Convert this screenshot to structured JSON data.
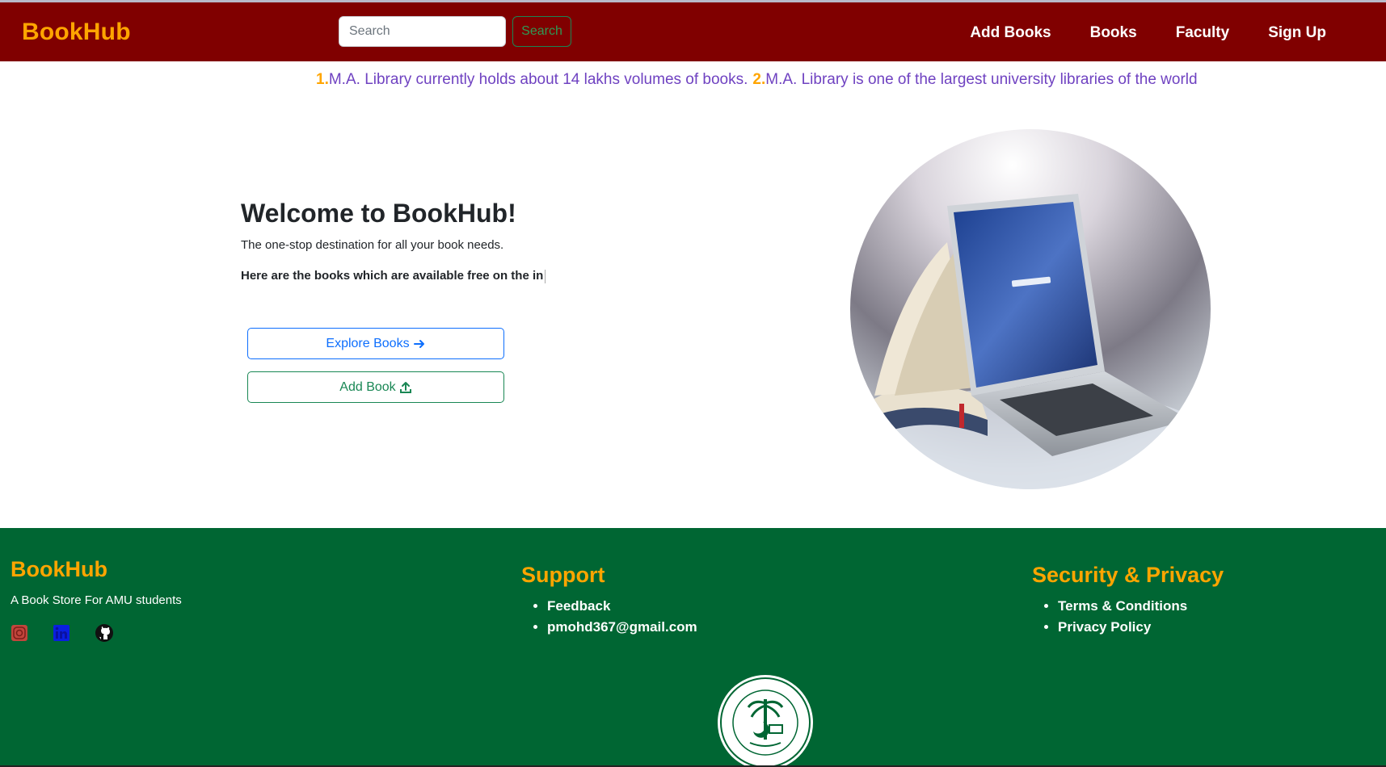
{
  "navbar": {
    "brand": "BookHub",
    "search_placeholder": "Search",
    "search_button": "Search",
    "links": [
      "Add Books",
      "Books",
      "Faculty",
      "Sign Up"
    ]
  },
  "facts": [
    {
      "num": "1.",
      "text": "M.A. Library currently holds about 14 lakhs volumes of books."
    },
    {
      "num": "2.",
      "text": "M.A. Library is one of the largest university libraries of the world"
    }
  ],
  "hero": {
    "title": "Welcome to BookHub!",
    "subtitle": "The one-stop destination for all your book needs.",
    "typed_text": "Here are the books which are available free on the in",
    "explore_button": "Explore Books",
    "add_button": "Add Book"
  },
  "footer": {
    "brand": "BookHub",
    "tagline": "A Book Store For AMU students",
    "support": {
      "heading": "Support",
      "items": [
        "Feedback",
        "pmohd367@gmail.com"
      ]
    },
    "security": {
      "heading": "Security & Privacy",
      "items": [
        "Terms & Conditions",
        "Privacy Policy"
      ]
    },
    "socials": [
      "instagram-icon",
      "linkedin-icon",
      "github-icon"
    ]
  },
  "colors": {
    "navbar": "#800000",
    "brand": "#ffa500",
    "footer": "#006633",
    "facts_text": "#6f42c1",
    "primary": "#0d6efd",
    "success": "#198754"
  }
}
